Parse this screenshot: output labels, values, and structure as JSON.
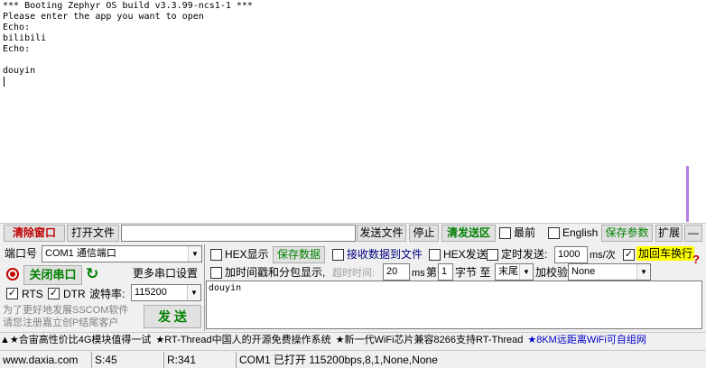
{
  "terminal": {
    "lines": [
      "*** Booting Zephyr OS build v3.3.99-ncs1-1 ***",
      "Please enter the app you want to open",
      "Echo:",
      "bilibili",
      "Echo:",
      "",
      "douyin"
    ]
  },
  "toolbar": {
    "clear_window": "清除窗口",
    "open_file": "打开文件",
    "file_path": "",
    "send_file": "发送文件",
    "stop": "停止",
    "clear_send": "清发送区",
    "topmost": "最前",
    "english": "English",
    "save_params": "保存参数",
    "expand": "扩展",
    "collapse": "—"
  },
  "port": {
    "label": "端口号",
    "value": "COM1 通信端口",
    "close_button": "关闭串口",
    "more_settings": "更多串口设置",
    "rts": "RTS",
    "dtr": "DTR",
    "baud_label": "波特率:",
    "baud_value": "115200",
    "promo_line1": "为了更好地发展SSCOM软件",
    "promo_line2": "请您注册嘉立创P结尾客户",
    "send_button": "发  送"
  },
  "options": {
    "hex_display": "HEX显示",
    "save_data": "保存数据",
    "receive_to_file": "接收数据到文件",
    "hex_send": "HEX发送",
    "timed_send": "定时发送:",
    "interval": "1000",
    "interval_unit": "ms/次",
    "append_newline": "加回车换行",
    "help": "?",
    "timestamp": "加时间戳和分包显示,",
    "timeout_label": "超时时间:",
    "timeout_value": "20",
    "ms": "ms",
    "byte_label": "第",
    "byte_value": "1",
    "byte_to": "字节 至",
    "end_value": "末尾",
    "checksum_label": "加校验",
    "checksum_value": "None"
  },
  "send_text": "douyin",
  "ads": [
    "▲★合宙高性价比4G模块值得一试",
    "★RT-Thread中国人的开源免费操作系统",
    "★新一代WiFi芯片兼容8266支持RT-Thread",
    "★8KM远距离WiFi可自组网"
  ],
  "status": {
    "website": "www.daxia.com",
    "sent": "S:45",
    "received": "R:341",
    "port_info": "COM1 已打开  115200bps,8,1,None,None"
  },
  "colors": {
    "accent_red": "#c00000",
    "accent_green": "#008000",
    "highlight_yellow": "#ffff00",
    "ad_blue": "#0000c8"
  }
}
